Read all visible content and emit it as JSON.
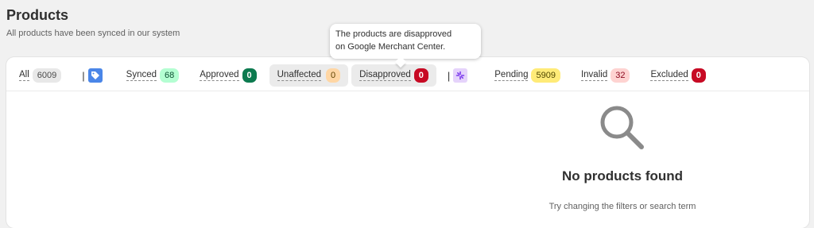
{
  "header": {
    "title": "Products",
    "subtitle": "All products have been synced in our system"
  },
  "tabs": {
    "all": {
      "label": "All",
      "count": "6009"
    },
    "separator": "|",
    "synced": {
      "label": "Synced",
      "count": "68"
    },
    "approved": {
      "label": "Approved",
      "count": "0"
    },
    "unaffected": {
      "label": "Unaffected",
      "count": "0"
    },
    "disapproved": {
      "label": "Disapproved",
      "count": "0"
    },
    "pending": {
      "label": "Pending",
      "count": "5909"
    },
    "invalid": {
      "label": "Invalid",
      "count": "32"
    },
    "excluded": {
      "label": "Excluded",
      "count": "0"
    }
  },
  "icons": {
    "gmc": "google-merchant-tag-icon",
    "spark": "sparkle-icon",
    "empty": "search-icon"
  },
  "tooltip": {
    "line1": "The products are disapproved",
    "line2": "on Google Merchant Center."
  },
  "empty_state": {
    "title": "No products found",
    "description": "Try changing the filters or search term"
  },
  "colors": {
    "gmc_icon": "#4a86e8",
    "spark_icon": "#e5d3fb",
    "danger": "#c70a24",
    "success": "#0c7a4f"
  }
}
